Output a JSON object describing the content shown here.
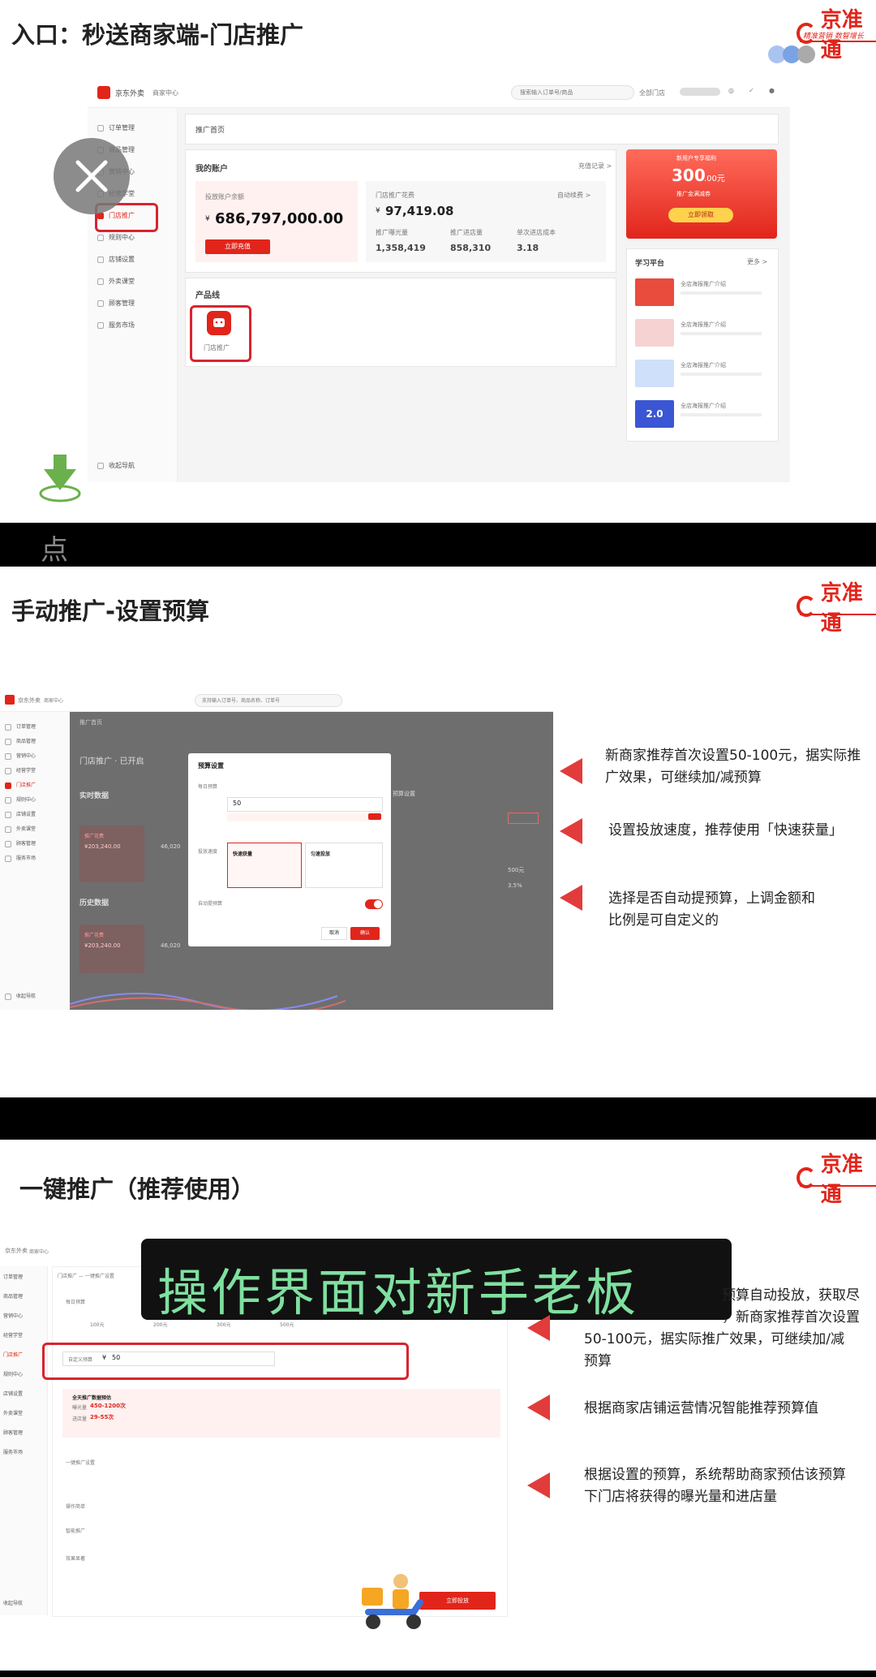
{
  "slide1": {
    "title": "入口：秒送商家端-门店推广",
    "brand": "京准通",
    "brand_slogan": "精准营销  数智增长",
    "app": {
      "app_name": "京东外卖",
      "app_sub": "商家中心",
      "search_placeholder": "搜索输入订单号/商品",
      "store_select": "全部门店",
      "sidebar": [
        "订单管理",
        "商品管理",
        "营销中心",
        "经营学堂",
        "门店推广",
        "规则中心",
        "店铺设置",
        "外卖课堂",
        "顾客管理",
        "服务市场"
      ],
      "sidebar_bottom": "收起导航",
      "breadcrumb": "推广首页",
      "my_account": "我的账户",
      "recharge_record": "充值记录 >",
      "balance_label": "投放账户余额",
      "balance_value": "686,797,000.00",
      "currency": "¥",
      "recharge_btn": "立即充值",
      "store_promo_label": "门店推广花费",
      "store_promo_value": "97,419.08",
      "auto_label": "自动续费 >",
      "stats": [
        {
          "label": "推广曝光量",
          "value": "1,358,419"
        },
        {
          "label": "推广进店量",
          "value": "858,310"
        },
        {
          "label": "单次进店成本",
          "value": "3.18"
        }
      ],
      "product_line": "产品线",
      "product_item": "门店推广",
      "coupon_title": "新用户专享福利",
      "coupon_value": "300",
      "coupon_unit": ".00元",
      "coupon_desc": "推广金满减券",
      "coupon_btn": "立即领取",
      "learn_title": "学习平台",
      "learn_more": "更多 >",
      "learn_items": [
        "全店海报推广介绍",
        "全店海报推广介绍",
        "全店海报推广介绍",
        "全店海报推广介绍"
      ],
      "learn_thumb_text": "2.0"
    },
    "watermark": "点"
  },
  "slide2": {
    "title": "手动推广-设置预算",
    "brand": "京准通",
    "app": {
      "app_name": "京东外卖",
      "app_sub": "商家中心",
      "search_placeholder": "支持输入订单号、商品名称、订单号",
      "sidebar": [
        "订单管理",
        "商品管理",
        "营销中心",
        "经营学堂",
        "门店推广",
        "规则中心",
        "店铺设置",
        "外卖课堂",
        "顾客管理",
        "服务市场"
      ],
      "sidebar_bottom": "收起导航",
      "breadcrumb": "推广首页",
      "status_title": "门店推广 · 已开启",
      "realtime": "实时数据",
      "history": "历史数据",
      "spend_label": "推广花费",
      "spend_value": "¥203,240.00",
      "exposure_value": "46,020",
      "modal_title": "预算设置",
      "daily_budget_label": "每日预算",
      "daily_budget_value": "50",
      "speed_label": "投放速度",
      "speed_fast": "快速获量",
      "speed_even": "匀速投放",
      "auto_label": "自动提预算",
      "cancel": "取消",
      "confirm": "确认",
      "budget_setting": "预算设置",
      "right_values": [
        "3.5%",
        "500元"
      ]
    },
    "notes": [
      "新商家推荐首次设置50-100元，据实际推",
      "广效果，可继续加/减预算",
      "设置投放速度，推荐使用「快速获量」",
      "选择是否自动提预算，上调金额和",
      "比例是可自定义的"
    ]
  },
  "slide3": {
    "title": "一键推广（推荐使用）",
    "brand": "京准通",
    "overlay_caption": "操作界面对新手老板",
    "app": {
      "app_name": "京东外卖",
      "app_sub": "商家中心",
      "tab": "门店推广 — 一键推广设置",
      "daily_budget": "每日预算",
      "presets": [
        "100元",
        "200元",
        "300元",
        "500元"
      ],
      "custom_label": "自定义预算",
      "custom_currency": "¥",
      "custom_value": "50",
      "estimate_title": "全天推广数据预估",
      "estimate_exposure_label": "曝光量",
      "estimate_exposure_value": "450-1200次",
      "estimate_visit_label": "进店量",
      "estimate_visit_value": "29-55次",
      "sections": [
        "一键推广设置",
        "操作简单",
        "智能推广",
        "效果显著"
      ],
      "start_btn": "立即投放",
      "sidebar": [
        "订单管理",
        "商品管理",
        "营销中心",
        "经营学堂",
        "门店推广",
        "规则中心",
        "店铺设置",
        "外卖课堂",
        "顾客管理",
        "服务市场"
      ],
      "sidebar_bottom": "收起导航"
    },
    "notes": [
      "预算自动投放，获取尽",
      "，新商家推荐首次设置",
      "50-100元，据实际推广效果，可继续加/减",
      "预算",
      "根据商家店铺运营情况智能推荐预算值",
      "根据设置的预算，系统帮助商家预估该预算",
      "下门店将获得的曝光量和进店量"
    ]
  },
  "colors": {
    "brand_red": "#e1251b",
    "arrow_red": "#e23b3b",
    "caption_green": "#7fe0a0"
  }
}
